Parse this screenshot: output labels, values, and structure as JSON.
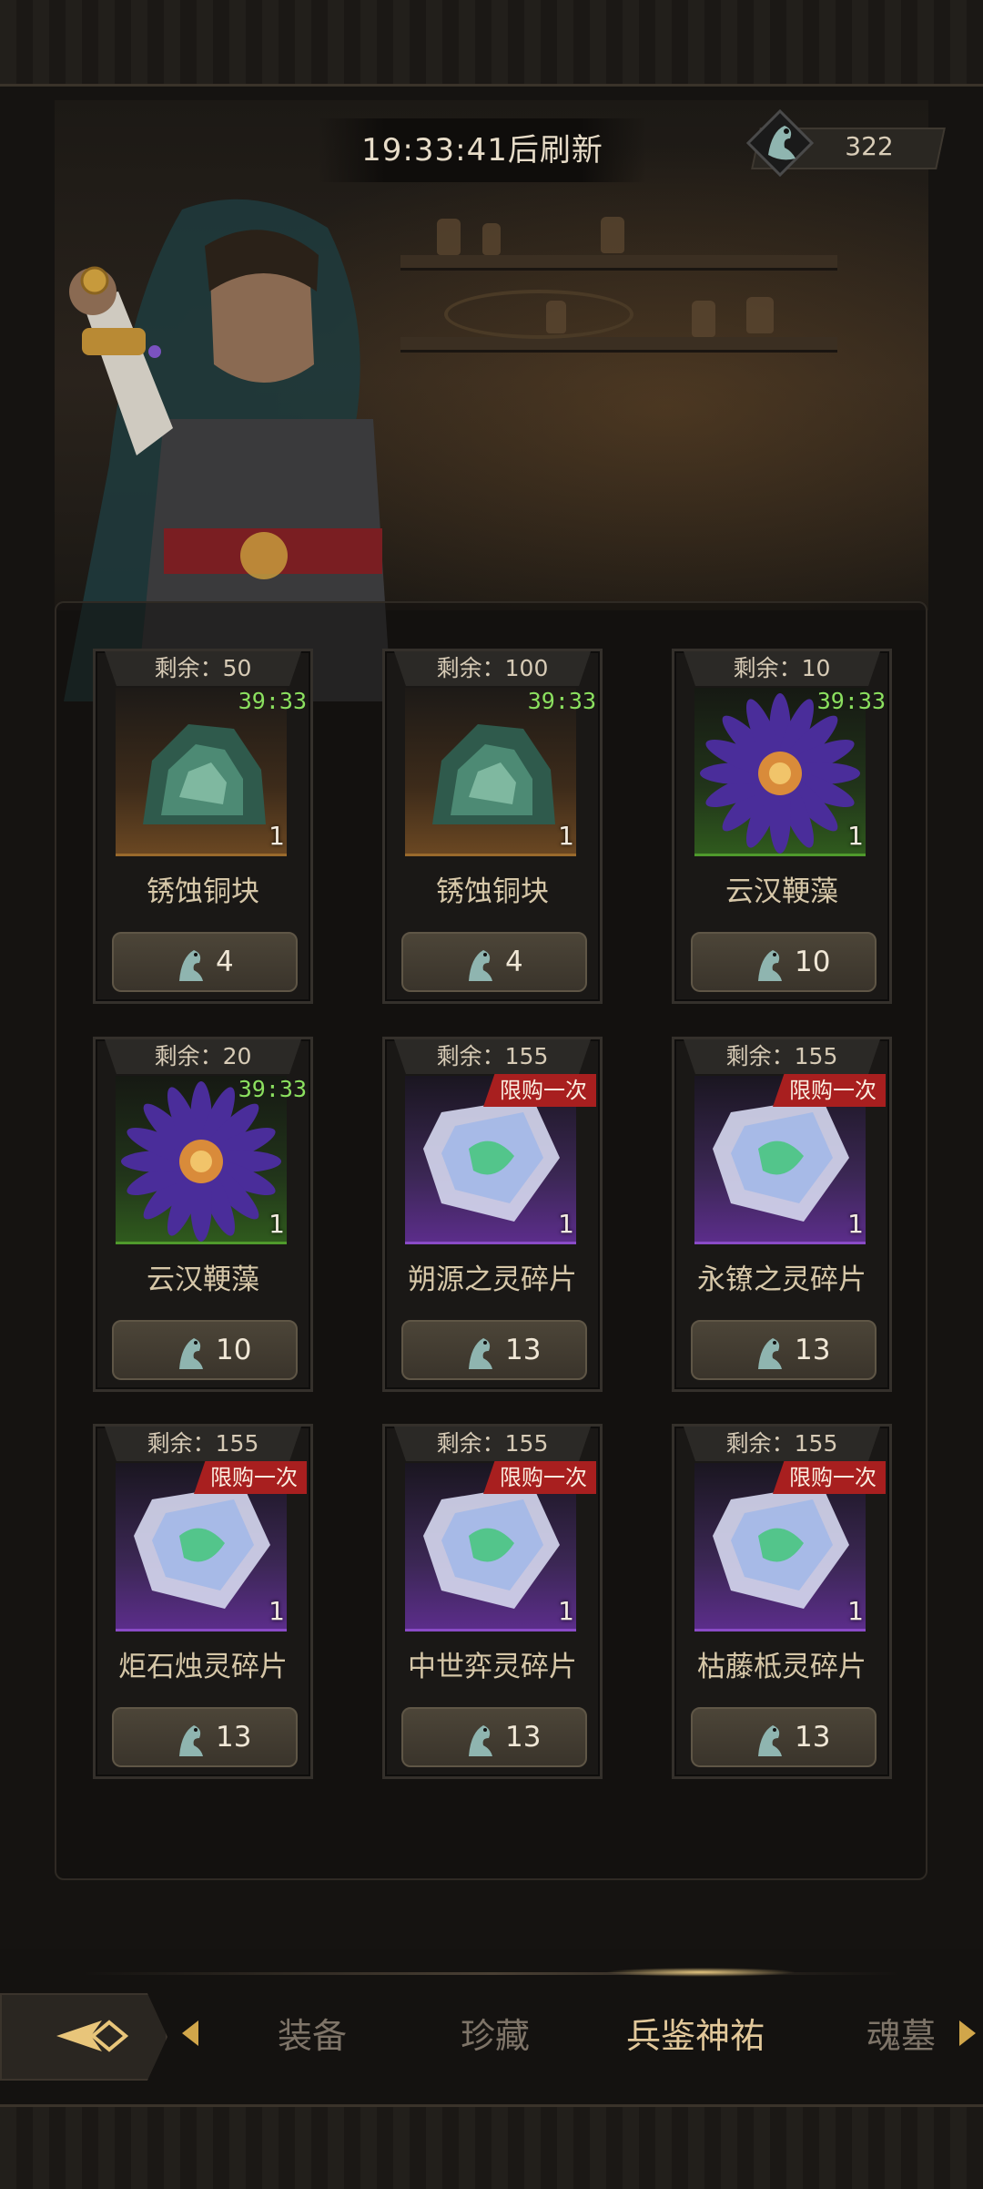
{
  "header": {
    "refresh_text": "19:33:41后刷新",
    "currency_amount": "322",
    "currency_icon": "dragon-emblem-icon"
  },
  "colors": {
    "timer_green": "#8be05f",
    "limit_red": "#a81f1f",
    "active_tab": "#e2c89a"
  },
  "items": [
    {
      "remain": "剩余：50",
      "timer": "39:33",
      "qty": "1",
      "name": "锈蚀铜块",
      "price": "4",
      "rarity": "orange",
      "icon": "copper-ore-icon",
      "limit": ""
    },
    {
      "remain": "剩余：100",
      "timer": "39:33",
      "qty": "1",
      "name": "锈蚀铜块",
      "price": "4",
      "rarity": "orange",
      "icon": "copper-ore-icon",
      "limit": ""
    },
    {
      "remain": "剩余：10",
      "timer": "39:33",
      "qty": "1",
      "name": "云汉鞕藻",
      "price": "10",
      "rarity": "green",
      "icon": "purple-flower-icon",
      "limit": ""
    },
    {
      "remain": "剩余：20",
      "timer": "39:33",
      "qty": "1",
      "name": "云汉鞕藻",
      "price": "10",
      "rarity": "green",
      "icon": "purple-flower-icon",
      "limit": ""
    },
    {
      "remain": "剩余：155",
      "timer": "",
      "qty": "1",
      "name": "朔源之灵碎片",
      "price": "13",
      "rarity": "purple",
      "icon": "spirit-crystal-icon",
      "limit": "限购一次"
    },
    {
      "remain": "剩余：155",
      "timer": "",
      "qty": "1",
      "name": "永镣之灵碎片",
      "price": "13",
      "rarity": "purple",
      "icon": "spirit-crystal-icon",
      "limit": "限购一次"
    },
    {
      "remain": "剩余：155",
      "timer": "",
      "qty": "1",
      "name": "炬石烛灵碎片",
      "price": "13",
      "rarity": "purple",
      "icon": "spirit-crystal-icon",
      "limit": "限购一次"
    },
    {
      "remain": "剩余：155",
      "timer": "",
      "qty": "1",
      "name": "中世弈灵碎片",
      "price": "13",
      "rarity": "purple",
      "icon": "spirit-crystal-icon",
      "limit": "限购一次"
    },
    {
      "remain": "剩余：155",
      "timer": "",
      "qty": "1",
      "name": "枯藤柢灵碎片",
      "price": "13",
      "rarity": "purple",
      "icon": "spirit-crystal-icon",
      "limit": "限购一次"
    }
  ],
  "tabs": [
    {
      "label": "装备",
      "active": false
    },
    {
      "label": "珍藏",
      "active": false
    },
    {
      "label": "兵鉴神祐",
      "active": true
    },
    {
      "label": "魂墓",
      "active": false
    }
  ]
}
